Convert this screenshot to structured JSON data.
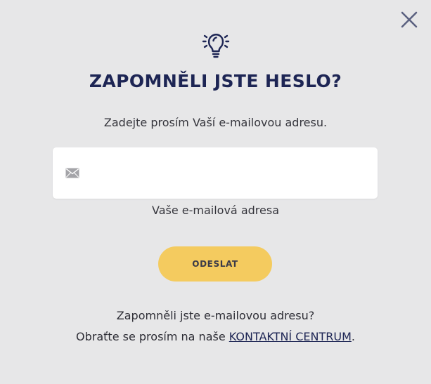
{
  "dialog": {
    "title": "ZAPOMNĚLI JSTE HESLO?",
    "subtitle": "Zadejte prosím Vaší e-mailovou adresu.",
    "icons": {
      "close": "close-icon",
      "header": "lightbulb-icon",
      "input": "envelope-icon"
    }
  },
  "form": {
    "email_value": "",
    "email_placeholder": "",
    "email_label": "Vaše e-mailová adresa",
    "submit_label": "ODESLAT"
  },
  "footer": {
    "line1": "Zapomněli jste e-mailovou adresu?",
    "line2_prefix": "Obraťte se prosím na naše ",
    "link_label": "KONTAKTNÍ CENTRUM",
    "line2_suffix": "."
  },
  "colors": {
    "background": "#e7e7e8",
    "title": "#1d2554",
    "button": "#f4cb5f",
    "input_bg": "#ffffff",
    "text": "#2d2d35"
  }
}
